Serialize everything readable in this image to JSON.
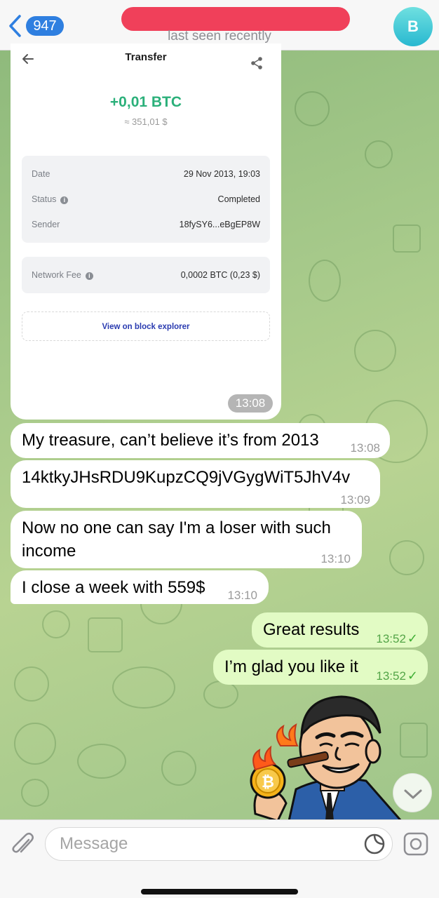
{
  "header": {
    "back_count": "947",
    "subtitle": "last seen recently",
    "avatar_letter": "B"
  },
  "transfer_screenshot": {
    "title": "Transfer",
    "amount": "+0,01 BTC",
    "fiat": "≈ 351,01 $",
    "rows": [
      {
        "label": "Date",
        "value": "29 Nov 2013, 19:03"
      },
      {
        "label": "Status",
        "value": "Completed"
      },
      {
        "label": "Sender",
        "value": "18fySY6...eBgEP8W"
      }
    ],
    "fee": {
      "label": "Network Fee",
      "value": "0,0002 BTC (0,23 $)"
    },
    "explorer_link": "View on block explorer",
    "time": "13:08"
  },
  "messages": [
    {
      "text": "My treasure, can’t believe it’s from 2013",
      "time": "13:08"
    },
    {
      "text": "14ktkyJHsRDU9KupzCQ9jVGygWiT5JhV4v",
      "time": "13:09"
    },
    {
      "text": "Now no one can say I'm a loser with such income",
      "time": "13:10"
    },
    {
      "text": "I close a week with 559$",
      "time": "13:10"
    },
    {
      "text": "Great results",
      "time": "13:52"
    },
    {
      "text": "I’m glad you like it",
      "time": "13:52"
    }
  ],
  "input": {
    "placeholder": "Message"
  },
  "colors": {
    "accent": "#2f7fe0",
    "outgoing": "#e2fbc4",
    "amount_green": "#2bb07a"
  }
}
